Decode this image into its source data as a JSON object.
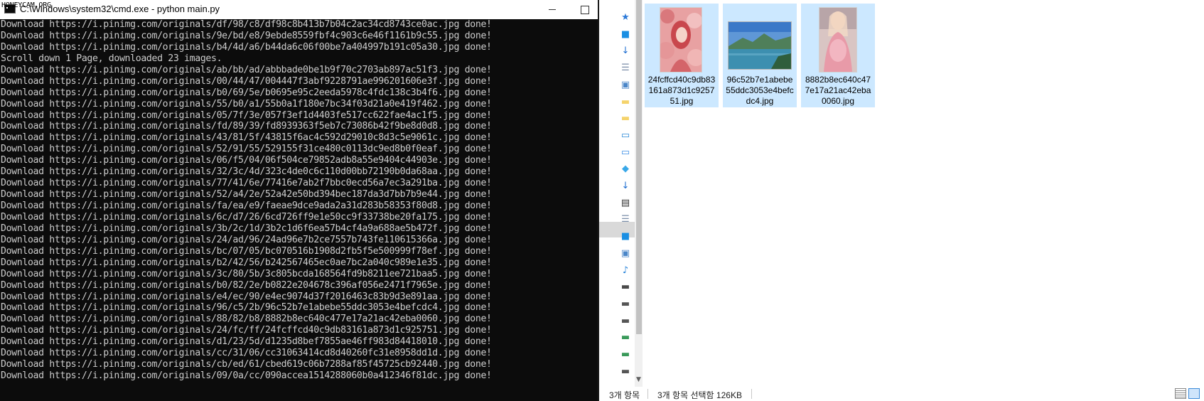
{
  "cmd": {
    "watermark": "HONEYCAM.ORG",
    "title": "C:\\Windows\\system32\\cmd.exe - python  main.py",
    "lines": [
      "Download https://i.pinimg.com/originals/df/98/c8/df98c8b413b7b04c2ac34cd8743ce0ac.jpg done!",
      "Download https://i.pinimg.com/originals/9e/bd/e8/9ebde8559fbf4c903c6e46f1161b9c55.jpg done!",
      "Download https://i.pinimg.com/originals/b4/4d/a6/b44da6c06f00be7a404997b191c05a30.jpg done!",
      "Scroll down 1 Page, downloaded 23 images.",
      "Download https://i.pinimg.com/originals/ab/bb/ad/abbbade0be1b9f70c2703ab897ac51f3.jpg done!",
      "Download https://i.pinimg.com/originals/00/44/47/004447f3abf9228791ae996201606e3f.jpg done!",
      "Download https://i.pinimg.com/originals/b0/69/5e/b0695e95c2eeda5978c4fdc138c3b4f6.jpg done!",
      "Download https://i.pinimg.com/originals/55/b0/a1/55b0a1f180e7bc34f03d21a0e419f462.jpg done!",
      "Download https://i.pinimg.com/originals/05/7f/3e/057f3ef1d4403fe517cc622fae4ac1f5.jpg done!",
      "Download https://i.pinimg.com/originals/fd/89/39/fd8939363f5eb7c73086b42f9be8d0d8.jpg done!",
      "Download https://i.pinimg.com/originals/43/81/5f/43815f6ac4c592d29010c8d3c5e9061c.jpg done!",
      "Download https://i.pinimg.com/originals/52/91/55/529155f31ce480c0113dc9ed8b0f0eaf.jpg done!",
      "Download https://i.pinimg.com/originals/06/f5/04/06f504ce79852adb8a55e9404c44903e.jpg done!",
      "Download https://i.pinimg.com/originals/32/3c/4d/323c4de0c6c110d00bb72190b0da68aa.jpg done!",
      "Download https://i.pinimg.com/originals/77/41/6e/77416e7ab2f7bbc0ecd56a7ec3a291ba.jpg done!",
      "Download https://i.pinimg.com/originals/52/a4/2e/52a42e50bd394bec187da3d7bb7b9e44.jpg done!",
      "Download https://i.pinimg.com/originals/fa/ea/e9/faeae9dce9ada2a31d283b58353f80d8.jpg done!",
      "Download https://i.pinimg.com/originals/6c/d7/26/6cd726ff9e1e50cc9f33738be20fa175.jpg done!",
      "Download https://i.pinimg.com/originals/3b/2c/1d/3b2c1d6f6ea57b4cf4a9a688ae5b472f.jpg done!",
      "Download https://i.pinimg.com/originals/24/ad/96/24ad96e7b2ce7557b743fe110615366a.jpg done!",
      "Download https://i.pinimg.com/originals/bc/07/05/bc070516b1908d2fb5f5e500999f78ef.jpg done!",
      "Download https://i.pinimg.com/originals/b2/42/56/b242567465ec0ae7bc2a040c989e1e35.jpg done!",
      "Download https://i.pinimg.com/originals/3c/80/5b/3c805bcda168564fd9b8211ee721baa5.jpg done!",
      "Download https://i.pinimg.com/originals/b0/82/2e/b0822e204678c396af056e2471f7965e.jpg done!",
      "Download https://i.pinimg.com/originals/e4/ec/90/e4ec9074d37f2016463c83b9d3e891aa.jpg done!",
      "Download https://i.pinimg.com/originals/96/c5/2b/96c52b7e1abebe55ddc3053e4befcdc4.jpg done!",
      "Download https://i.pinimg.com/originals/88/82/b8/8882b8ec640c477e17a21ac42eba0060.jpg done!",
      "Download https://i.pinimg.com/originals/24/fc/ff/24fcffcd40c9db83161a873d1c925751.jpg done!",
      "Download https://i.pinimg.com/originals/d1/23/5d/d1235d8bef7855ae46ff983d84418010.jpg done!",
      "Download https://i.pinimg.com/originals/cc/31/06/cc31063414cd8d40260fc31e8958dd1d.jpg done!",
      "Download https://i.pinimg.com/originals/cb/ed/61/cbed619c06b7288af85f45725cb92440.jpg done!",
      "Download https://i.pinimg.com/originals/09/0a/cc/090accea1514288060b0a412346f81dc.jpg done!"
    ]
  },
  "explorer": {
    "files": [
      {
        "name": "24fcffcd40c9db83161a873d1c925751.jpg",
        "thumb": "pink-portrait"
      },
      {
        "name": "96c52b7e1abebe55ddc3053e4befcdc4.jpg",
        "thumb": "landscape"
      },
      {
        "name": "8882b8ec640c477e17a21ac42eba0060.jpg",
        "thumb": "pink-figure"
      }
    ],
    "status": {
      "item_count": "3개 항목",
      "selected": "3개 항목 선택함 126KB"
    },
    "nav_icons": [
      "pin-icon",
      "desktop-icon",
      "download-icon",
      "document-icon",
      "picture-icon",
      "folder-icon",
      "folder-icon",
      "monitor-icon",
      "pc-icon",
      "cube-icon",
      "download-icon",
      "video-icon",
      "document-icon",
      "desktop-icon",
      "picture-icon",
      "music-icon",
      "windows-drive-icon",
      "drive-icon",
      "drive-icon",
      "network-drive-icon",
      "network-drive-icon",
      "drive-icon"
    ]
  },
  "colors": {
    "console_bg": "#0c0c0c",
    "console_fg": "#cccccc",
    "selection": "#cce8ff"
  }
}
